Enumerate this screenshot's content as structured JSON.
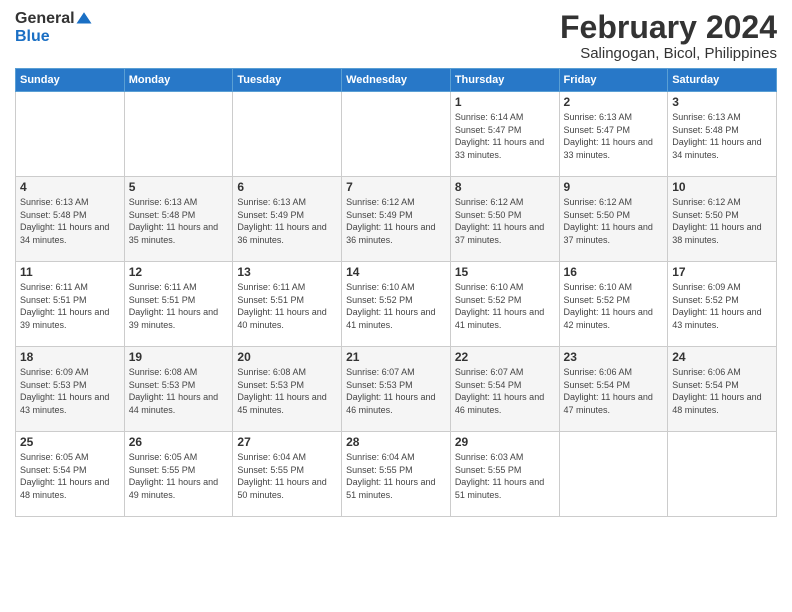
{
  "header": {
    "logo_general": "General",
    "logo_blue": "Blue",
    "title": "February 2024",
    "subtitle": "Salingogan, Bicol, Philippines"
  },
  "days_of_week": [
    "Sunday",
    "Monday",
    "Tuesday",
    "Wednesday",
    "Thursday",
    "Friday",
    "Saturday"
  ],
  "weeks": [
    [
      {
        "day": "",
        "info": ""
      },
      {
        "day": "",
        "info": ""
      },
      {
        "day": "",
        "info": ""
      },
      {
        "day": "",
        "info": ""
      },
      {
        "day": "1",
        "info": "Sunrise: 6:14 AM\nSunset: 5:47 PM\nDaylight: 11 hours and 33 minutes."
      },
      {
        "day": "2",
        "info": "Sunrise: 6:13 AM\nSunset: 5:47 PM\nDaylight: 11 hours and 33 minutes."
      },
      {
        "day": "3",
        "info": "Sunrise: 6:13 AM\nSunset: 5:48 PM\nDaylight: 11 hours and 34 minutes."
      }
    ],
    [
      {
        "day": "4",
        "info": "Sunrise: 6:13 AM\nSunset: 5:48 PM\nDaylight: 11 hours and 34 minutes."
      },
      {
        "day": "5",
        "info": "Sunrise: 6:13 AM\nSunset: 5:48 PM\nDaylight: 11 hours and 35 minutes."
      },
      {
        "day": "6",
        "info": "Sunrise: 6:13 AM\nSunset: 5:49 PM\nDaylight: 11 hours and 36 minutes."
      },
      {
        "day": "7",
        "info": "Sunrise: 6:12 AM\nSunset: 5:49 PM\nDaylight: 11 hours and 36 minutes."
      },
      {
        "day": "8",
        "info": "Sunrise: 6:12 AM\nSunset: 5:50 PM\nDaylight: 11 hours and 37 minutes."
      },
      {
        "day": "9",
        "info": "Sunrise: 6:12 AM\nSunset: 5:50 PM\nDaylight: 11 hours and 37 minutes."
      },
      {
        "day": "10",
        "info": "Sunrise: 6:12 AM\nSunset: 5:50 PM\nDaylight: 11 hours and 38 minutes."
      }
    ],
    [
      {
        "day": "11",
        "info": "Sunrise: 6:11 AM\nSunset: 5:51 PM\nDaylight: 11 hours and 39 minutes."
      },
      {
        "day": "12",
        "info": "Sunrise: 6:11 AM\nSunset: 5:51 PM\nDaylight: 11 hours and 39 minutes."
      },
      {
        "day": "13",
        "info": "Sunrise: 6:11 AM\nSunset: 5:51 PM\nDaylight: 11 hours and 40 minutes."
      },
      {
        "day": "14",
        "info": "Sunrise: 6:10 AM\nSunset: 5:52 PM\nDaylight: 11 hours and 41 minutes."
      },
      {
        "day": "15",
        "info": "Sunrise: 6:10 AM\nSunset: 5:52 PM\nDaylight: 11 hours and 41 minutes."
      },
      {
        "day": "16",
        "info": "Sunrise: 6:10 AM\nSunset: 5:52 PM\nDaylight: 11 hours and 42 minutes."
      },
      {
        "day": "17",
        "info": "Sunrise: 6:09 AM\nSunset: 5:52 PM\nDaylight: 11 hours and 43 minutes."
      }
    ],
    [
      {
        "day": "18",
        "info": "Sunrise: 6:09 AM\nSunset: 5:53 PM\nDaylight: 11 hours and 43 minutes."
      },
      {
        "day": "19",
        "info": "Sunrise: 6:08 AM\nSunset: 5:53 PM\nDaylight: 11 hours and 44 minutes."
      },
      {
        "day": "20",
        "info": "Sunrise: 6:08 AM\nSunset: 5:53 PM\nDaylight: 11 hours and 45 minutes."
      },
      {
        "day": "21",
        "info": "Sunrise: 6:07 AM\nSunset: 5:53 PM\nDaylight: 11 hours and 46 minutes."
      },
      {
        "day": "22",
        "info": "Sunrise: 6:07 AM\nSunset: 5:54 PM\nDaylight: 11 hours and 46 minutes."
      },
      {
        "day": "23",
        "info": "Sunrise: 6:06 AM\nSunset: 5:54 PM\nDaylight: 11 hours and 47 minutes."
      },
      {
        "day": "24",
        "info": "Sunrise: 6:06 AM\nSunset: 5:54 PM\nDaylight: 11 hours and 48 minutes."
      }
    ],
    [
      {
        "day": "25",
        "info": "Sunrise: 6:05 AM\nSunset: 5:54 PM\nDaylight: 11 hours and 48 minutes."
      },
      {
        "day": "26",
        "info": "Sunrise: 6:05 AM\nSunset: 5:55 PM\nDaylight: 11 hours and 49 minutes."
      },
      {
        "day": "27",
        "info": "Sunrise: 6:04 AM\nSunset: 5:55 PM\nDaylight: 11 hours and 50 minutes."
      },
      {
        "day": "28",
        "info": "Sunrise: 6:04 AM\nSunset: 5:55 PM\nDaylight: 11 hours and 51 minutes."
      },
      {
        "day": "29",
        "info": "Sunrise: 6:03 AM\nSunset: 5:55 PM\nDaylight: 11 hours and 51 minutes."
      },
      {
        "day": "",
        "info": ""
      },
      {
        "day": "",
        "info": ""
      }
    ]
  ]
}
